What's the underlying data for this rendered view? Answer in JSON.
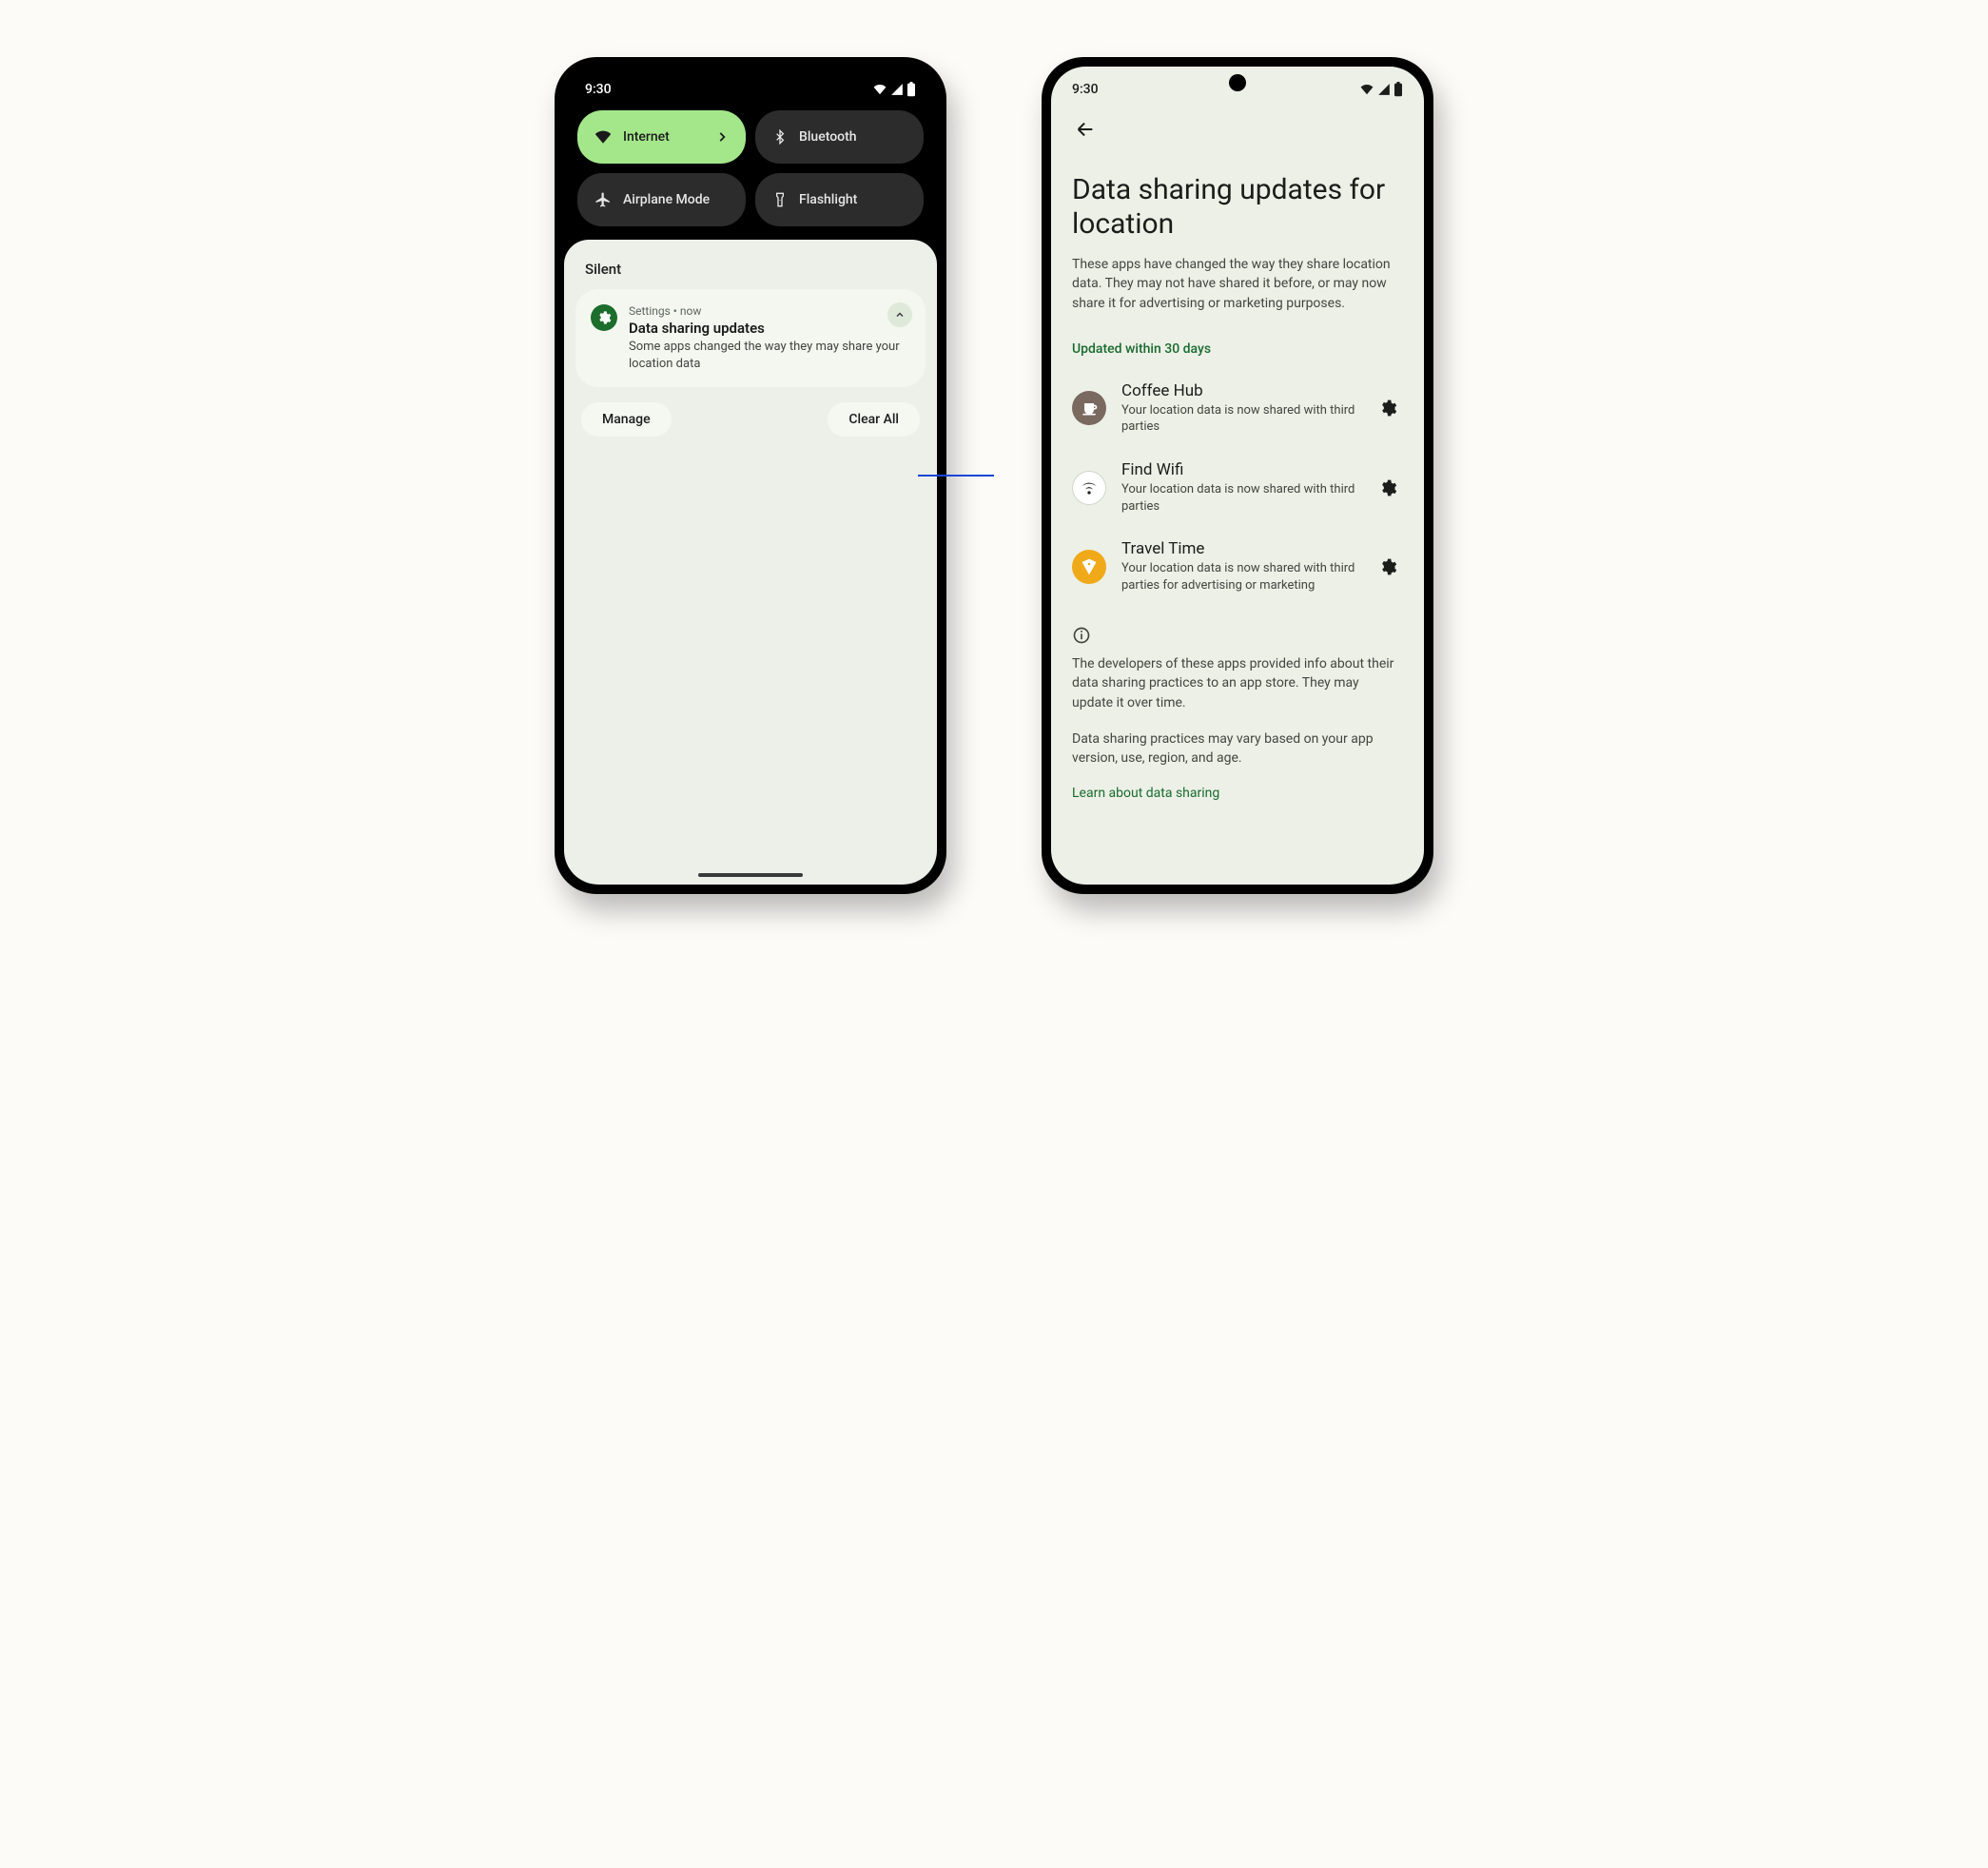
{
  "phone1": {
    "status": {
      "time": "9:30"
    },
    "qs": {
      "internet": "Internet",
      "bluetooth": "Bluetooth",
      "airplane": "Airplane Mode",
      "flashlight": "Flashlight"
    },
    "shade": {
      "silent_label": "Silent",
      "notification": {
        "app": "Settings",
        "sep": "  •  ",
        "time": "now",
        "title": "Data sharing updates",
        "body": "Some apps changed the way they may share your location data"
      },
      "manage": "Manage",
      "clear_all": "Clear All"
    }
  },
  "phone2": {
    "status": {
      "time": "9:30"
    },
    "title": "Data sharing updates for location",
    "description": "These apps have changed the way they share location data. They may not have shared it before, or may now share it for advertising or marketing purposes.",
    "section_label": "Updated within 30 days",
    "apps": [
      {
        "name": "Coffee Hub",
        "sub": "Your location data is now shared with third parties",
        "icon_bg": "#79695f",
        "icon_fg": "#ffffff",
        "icon": "coffee"
      },
      {
        "name": "Find Wifi",
        "sub": "Your location data is now shared with third parties",
        "icon_bg": "#ffffff",
        "icon_fg": "#1b1d1a",
        "icon": "wifi"
      },
      {
        "name": "Travel Time",
        "sub": "Your location data is now shared with third parties for advertising or marketing",
        "icon_bg": "#f0a918",
        "icon_fg": "#ffffff",
        "icon": "tag"
      }
    ],
    "info1": "The developers of these apps provided info about their data sharing practices to an app store. They may update it over time.",
    "info2": "Data sharing practices may vary based on your app version, use, region, and age.",
    "learn": "Learn about data sharing"
  }
}
